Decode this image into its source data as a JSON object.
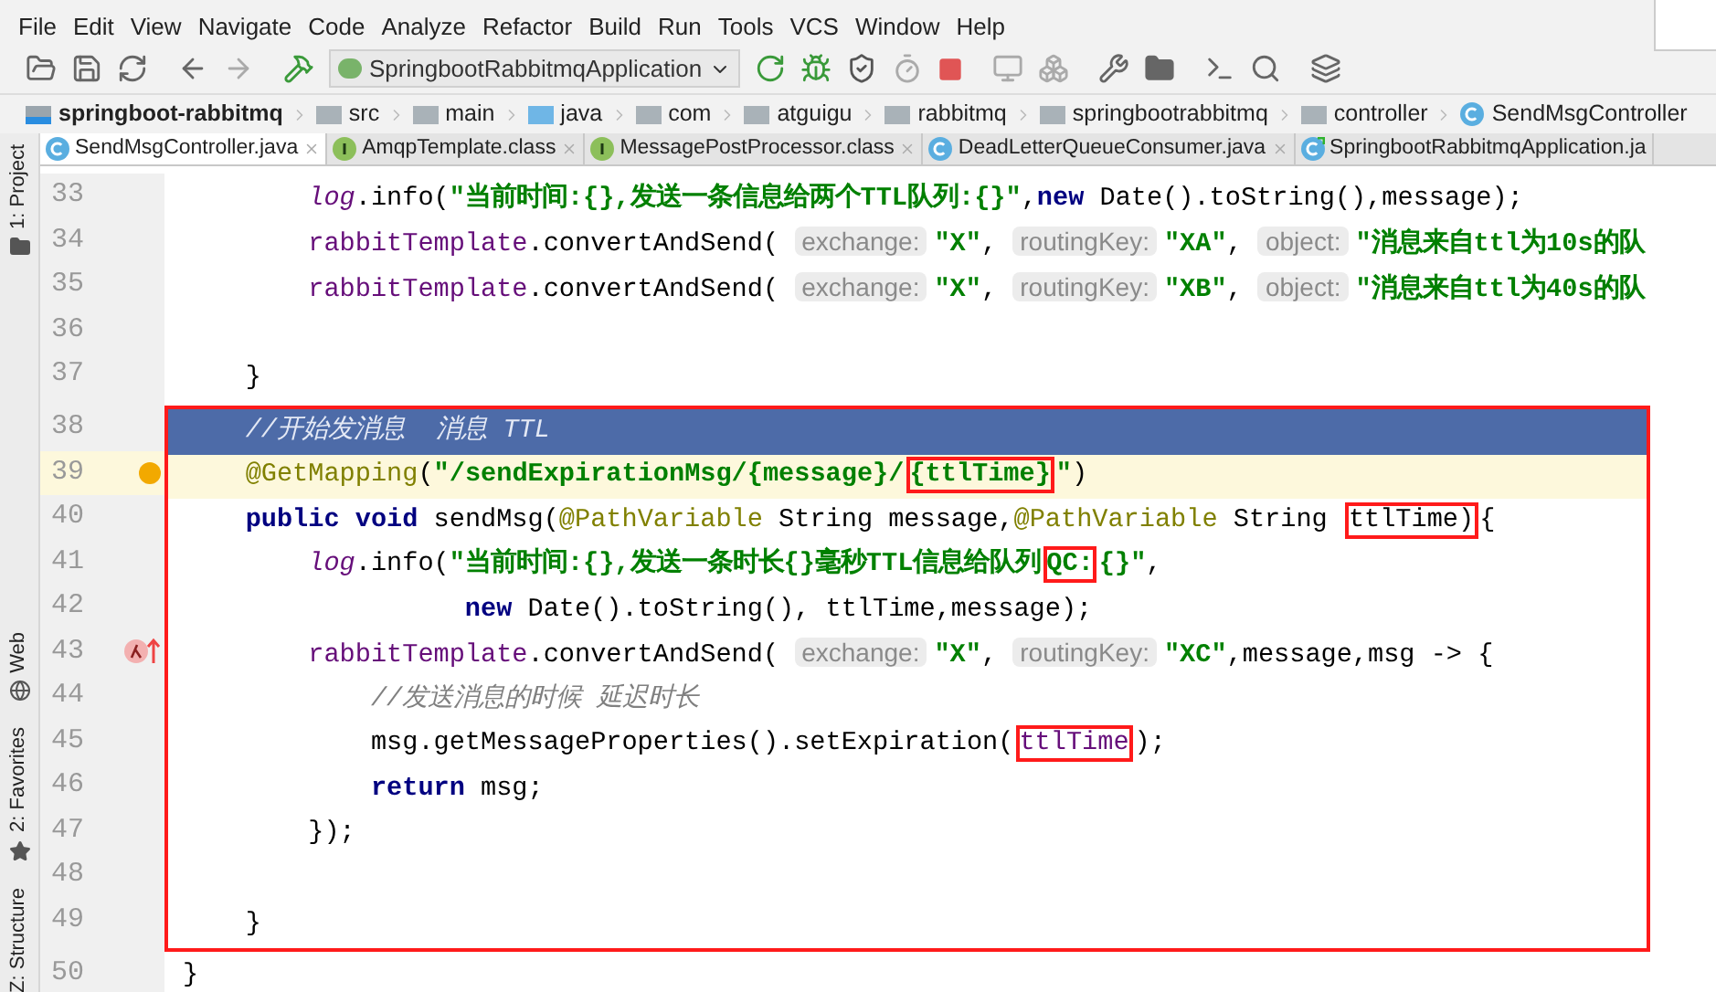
{
  "menu": [
    "File",
    "Edit",
    "View",
    "Navigate",
    "Code",
    "Analyze",
    "Refactor",
    "Build",
    "Run",
    "Tools",
    "VCS",
    "Window",
    "Help"
  ],
  "run_config": "SpringbootRabbitmqApplication",
  "breadcrumbs": [
    {
      "label": "springboot-rabbitmq",
      "kind": "module"
    },
    {
      "label": "src",
      "kind": "folder"
    },
    {
      "label": "main",
      "kind": "folder"
    },
    {
      "label": "java",
      "kind": "source"
    },
    {
      "label": "com",
      "kind": "folder"
    },
    {
      "label": "atguigu",
      "kind": "folder"
    },
    {
      "label": "rabbitmq",
      "kind": "folder"
    },
    {
      "label": "springbootrabbitmq",
      "kind": "folder"
    },
    {
      "label": "controller",
      "kind": "folder"
    },
    {
      "label": "SendMsgController",
      "kind": "class"
    }
  ],
  "tabs": [
    {
      "label": "SendMsgController.java",
      "kind": "class",
      "selected": true
    },
    {
      "label": "AmqpTemplate.class",
      "kind": "interface",
      "selected": false
    },
    {
      "label": "MessagePostProcessor.class",
      "kind": "interface",
      "selected": false
    },
    {
      "label": "DeadLetterQueueConsumer.java",
      "kind": "class",
      "selected": false
    },
    {
      "label": "SpringbootRabbitmqApplication.ja",
      "kind": "app",
      "selected": false
    }
  ],
  "side_tools": [
    "1: Project",
    "Web",
    "2: Favorites",
    "Z: Structure"
  ],
  "code": {
    "groups": [
      {
        "framed": false,
        "lines": [
          {
            "n": "33",
            "kind": "plain",
            "selected": false,
            "current": false,
            "tokens": [
              {
                "kind": "static",
                "text": "        log"
              },
              {
                "kind": "plain",
                "text": ".info("
              },
              {
                "kind": "str",
                "text": "\"当前时间:{},发送一条信息给两个TTL队列:{}\""
              },
              {
                "kind": "plain",
                "text": ","
              },
              {
                "kind": "kw",
                "text": "new"
              },
              {
                "kind": "plain",
                "text": " Date().toString(),message);"
              }
            ]
          },
          {
            "n": "34",
            "kind": "plain",
            "selected": false,
            "current": false,
            "tokens": [
              {
                "kind": "field",
                "text": "        rabbitTemplate"
              },
              {
                "kind": "plain",
                "text": ".convertAndSend( "
              },
              {
                "kind": "hint",
                "text": "exchange:"
              },
              {
                "kind": "str",
                "text": "\"X\""
              },
              {
                "kind": "plain",
                "text": ", "
              },
              {
                "kind": "hint",
                "text": "routingKey:"
              },
              {
                "kind": "str",
                "text": "\"XA\""
              },
              {
                "kind": "plain",
                "text": ", "
              },
              {
                "kind": "hint",
                "text": "object:"
              },
              {
                "kind": "str",
                "text": "\"消息来自ttl为10s的队"
              }
            ]
          },
          {
            "n": "35",
            "kind": "plain",
            "selected": false,
            "current": false,
            "tokens": [
              {
                "kind": "field",
                "text": "        rabbitTemplate"
              },
              {
                "kind": "plain",
                "text": ".convertAndSend( "
              },
              {
                "kind": "hint",
                "text": "exchange:"
              },
              {
                "kind": "str",
                "text": "\"X\""
              },
              {
                "kind": "plain",
                "text": ", "
              },
              {
                "kind": "hint",
                "text": "routingKey:"
              },
              {
                "kind": "str",
                "text": "\"XB\""
              },
              {
                "kind": "plain",
                "text": ", "
              },
              {
                "kind": "hint",
                "text": "object:"
              },
              {
                "kind": "str",
                "text": "\"消息来自ttl为40s的队"
              }
            ]
          },
          {
            "n": "36",
            "kind": "plain",
            "selected": false,
            "current": false
          },
          {
            "n": "37",
            "kind": "plain",
            "selected": false,
            "current": false,
            "tokens": [
              {
                "kind": "plain",
                "text": "    }"
              }
            ]
          }
        ]
      },
      {
        "framed": true,
        "lines": [
          {
            "n": "38",
            "kind": "plain",
            "selected": true,
            "current": false,
            "tokens": [
              {
                "kind": "comment",
                "text": "    //开始发消息  消息 TTL"
              }
            ]
          },
          {
            "n": "39",
            "kind": "bulb",
            "selected": false,
            "current": true,
            "tokens": [
              {
                "kind": "ann",
                "text": "    @GetMapping"
              },
              {
                "kind": "plain",
                "text": "("
              },
              {
                "kind": "str",
                "text": "\"/sendExpirationMsg/{message}/"
              },
              {
                "kind": "str",
                "text": "{ttlTime}",
                "boxed": true
              },
              {
                "kind": "str",
                "text": "\""
              },
              {
                "kind": "plain",
                "text": ")"
              }
            ]
          },
          {
            "n": "40",
            "kind": "plain",
            "selected": false,
            "current": false,
            "tokens": [
              {
                "kind": "kw",
                "text": "    public"
              },
              {
                "kind": "kw",
                "text": " void"
              },
              {
                "kind": "plain",
                "text": " sendMsg("
              },
              {
                "kind": "ann",
                "text": "@PathVariable"
              },
              {
                "kind": "plain",
                "text": " String message,"
              },
              {
                "kind": "ann",
                "text": "@PathVariable"
              },
              {
                "kind": "plain",
                "text": " String "
              },
              {
                "kind": "plain",
                "text": "ttlTime)",
                "boxed": true
              },
              {
                "kind": "plain",
                "text": "{"
              }
            ]
          },
          {
            "n": "41",
            "kind": "plain",
            "selected": false,
            "current": false,
            "tokens": [
              {
                "kind": "static",
                "text": "        log"
              },
              {
                "kind": "plain",
                "text": ".info("
              },
              {
                "kind": "str",
                "text": "\"当前时间:{},发送一条时长{}毫秒TTL信息给队列"
              },
              {
                "kind": "str",
                "text": "QC:",
                "boxed": true
              },
              {
                "kind": "str",
                "text": "{}\""
              },
              {
                "kind": "plain",
                "text": ","
              }
            ]
          },
          {
            "n": "42",
            "kind": "plain",
            "selected": false,
            "current": false,
            "tokens": [
              {
                "kind": "kw",
                "text": "                  new"
              },
              {
                "kind": "plain",
                "text": " Date().toString(), ttlTime,message);"
              }
            ]
          },
          {
            "n": "43",
            "kind": "lambda",
            "selected": false,
            "current": false,
            "tokens": [
              {
                "kind": "field",
                "text": "        rabbitTemplate"
              },
              {
                "kind": "plain",
                "text": ".convertAndSend( "
              },
              {
                "kind": "hint",
                "text": "exchange:"
              },
              {
                "kind": "str",
                "text": "\"X\""
              },
              {
                "kind": "plain",
                "text": ", "
              },
              {
                "kind": "hint",
                "text": "routingKey:"
              },
              {
                "kind": "str",
                "text": "\"XC\""
              },
              {
                "kind": "plain",
                "text": ",message,msg -> {"
              }
            ]
          },
          {
            "n": "44",
            "kind": "plain",
            "selected": false,
            "current": false,
            "tokens": [
              {
                "kind": "comment",
                "text": "            //发送消息的时候 延迟时长"
              }
            ]
          },
          {
            "n": "45",
            "kind": "plain",
            "selected": false,
            "current": false,
            "tokens": [
              {
                "kind": "plain",
                "text": "            msg.getMessageProperties().setExpiration("
              },
              {
                "kind": "field",
                "text": "ttlTime",
                "boxed": true
              },
              {
                "kind": "plain",
                "text": ");"
              }
            ]
          },
          {
            "n": "46",
            "kind": "plain",
            "selected": false,
            "current": false,
            "tokens": [
              {
                "kind": "kw",
                "text": "            return"
              },
              {
                "kind": "plain",
                "text": " msg;"
              }
            ]
          },
          {
            "n": "47",
            "kind": "plain",
            "selected": false,
            "current": false,
            "tokens": [
              {
                "kind": "plain",
                "text": "        });"
              }
            ]
          },
          {
            "n": "48",
            "kind": "plain",
            "selected": false,
            "current": false
          },
          {
            "n": "49",
            "kind": "plain",
            "selected": false,
            "current": false,
            "tokens": [
              {
                "kind": "plain",
                "text": "    }"
              }
            ]
          }
        ]
      },
      {
        "framed": false,
        "lines": [
          {
            "n": "50",
            "kind": "plain",
            "selected": false,
            "current": false,
            "tokens": [
              {
                "kind": "plain",
                "text": "}"
              }
            ]
          }
        ]
      }
    ]
  }
}
